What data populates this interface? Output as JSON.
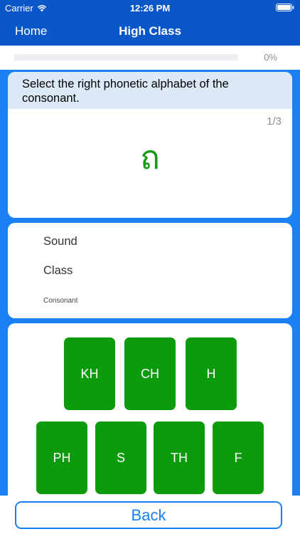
{
  "status_bar": {
    "carrier": "Carrier",
    "time": "12:26 PM"
  },
  "nav": {
    "back_label": "Home",
    "title": "High Class"
  },
  "progress": {
    "value_percent": 0,
    "label": "0%"
  },
  "question": {
    "prompt": "Select the right phonetic alphabet of the consonant.",
    "counter": "1/3",
    "consonant": "ถ"
  },
  "info": {
    "sound_label": "Sound",
    "class_label": "Class",
    "consonant_label": "Consonant"
  },
  "answers": [
    {
      "label": "KH"
    },
    {
      "label": "CH"
    },
    {
      "label": "H"
    },
    {
      "label": "PH"
    },
    {
      "label": "S"
    },
    {
      "label": "TH"
    },
    {
      "label": "F"
    }
  ],
  "footer": {
    "back_button": "Back"
  },
  "colors": {
    "header": "#0b57c7",
    "main_bg": "#1a80f5",
    "answer_green": "#0b9b0b",
    "consonant_green": "#169916"
  },
  "icons": {
    "wifi": "wifi-icon",
    "battery": "battery-icon"
  }
}
